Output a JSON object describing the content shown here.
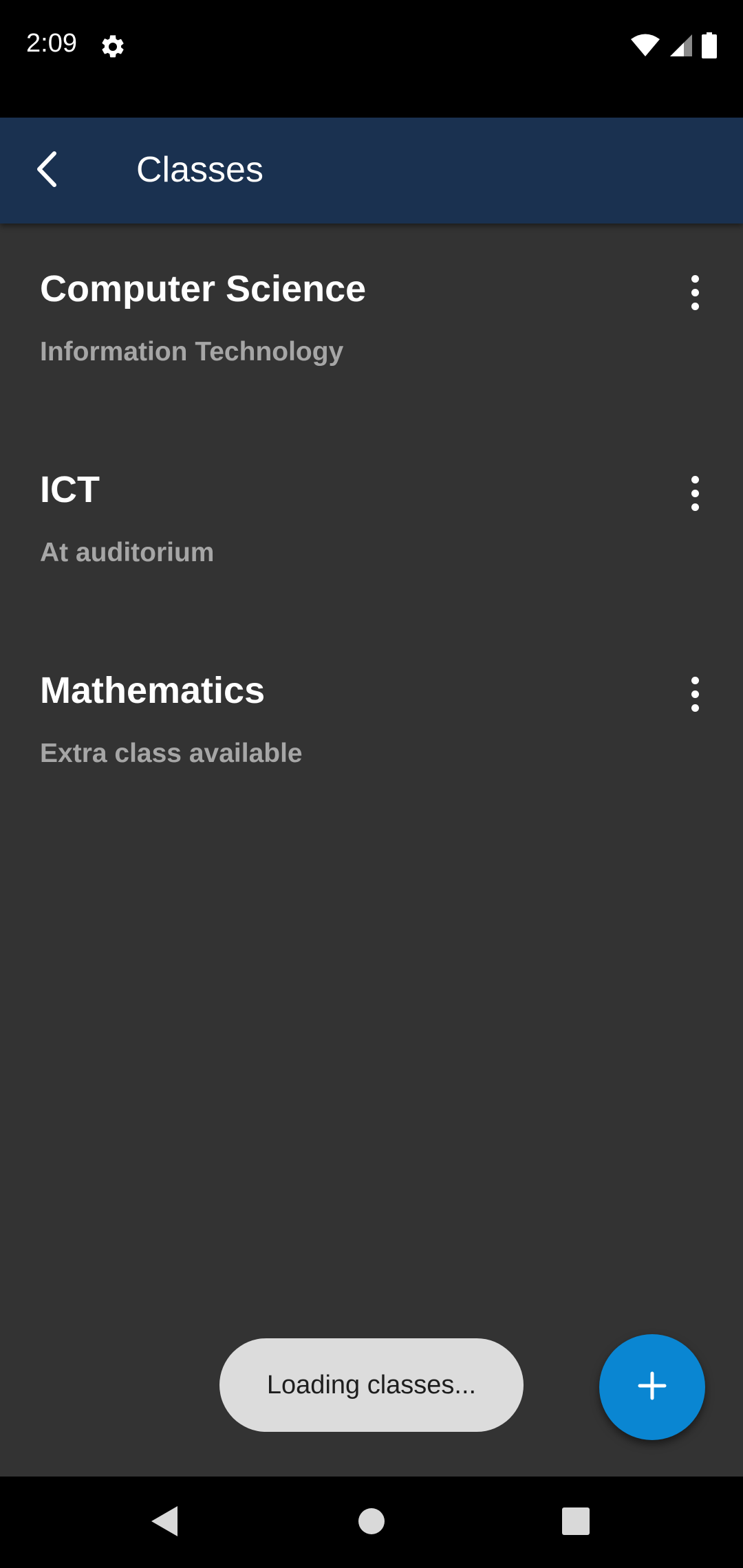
{
  "status_bar": {
    "time": "2:09",
    "icons": [
      "gear-icon",
      "wifi-icon",
      "signal-icon",
      "battery-icon"
    ]
  },
  "app_bar": {
    "title": "Classes",
    "background": "#1a3150",
    "back_icon": "back-arrow-icon"
  },
  "classes": [
    {
      "name": "Computer Science",
      "description": "Information Technology"
    },
    {
      "name": "ICT",
      "description": "At auditorium"
    },
    {
      "name": "Mathematics",
      "description": "Extra class available"
    }
  ],
  "toast": {
    "text": "Loading classes..."
  },
  "fab": {
    "icon": "plus-icon",
    "color": "#0a86d2"
  },
  "nav_bar": {
    "icons": [
      "nav-back-icon",
      "nav-home-icon",
      "nav-recents-icon"
    ]
  }
}
